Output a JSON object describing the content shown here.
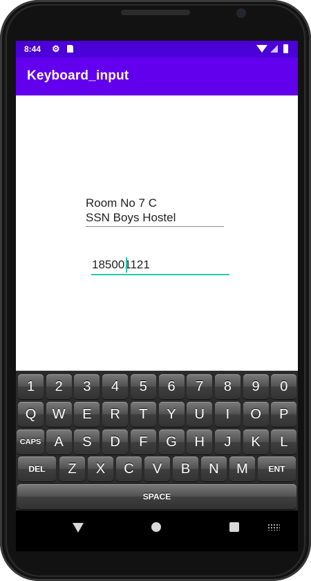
{
  "status_bar": {
    "time": "8:44"
  },
  "app_bar": {
    "title": "Keyboard_input"
  },
  "form": {
    "address_line1": "Room No 7 C",
    "address_line2": "SSN Boys Hostel",
    "number_value": "185001121"
  },
  "keyboard": {
    "rows": [
      [
        "1",
        "2",
        "3",
        "4",
        "5",
        "6",
        "7",
        "8",
        "9",
        "0"
      ],
      [
        "Q",
        "W",
        "E",
        "R",
        "T",
        "Y",
        "U",
        "I",
        "O",
        "P"
      ],
      [
        "CAPS",
        "A",
        "S",
        "D",
        "F",
        "G",
        "H",
        "J",
        "K",
        "L"
      ],
      [
        "DEL",
        "Z",
        "X",
        "C",
        "V",
        "B",
        "N",
        "M",
        "ENT"
      ],
      [
        "SPACE"
      ]
    ]
  },
  "colors": {
    "status_bar": "#4b00d8",
    "app_bar": "#6200ee",
    "accent": "#26c6b0"
  },
  "icons": {
    "status": [
      "gear-icon",
      "sd-card-icon",
      "wifi-icon",
      "signal-icon",
      "battery-icon"
    ],
    "nav": [
      "back-icon",
      "home-icon",
      "recents-icon",
      "keyboard-switch-icon"
    ]
  }
}
